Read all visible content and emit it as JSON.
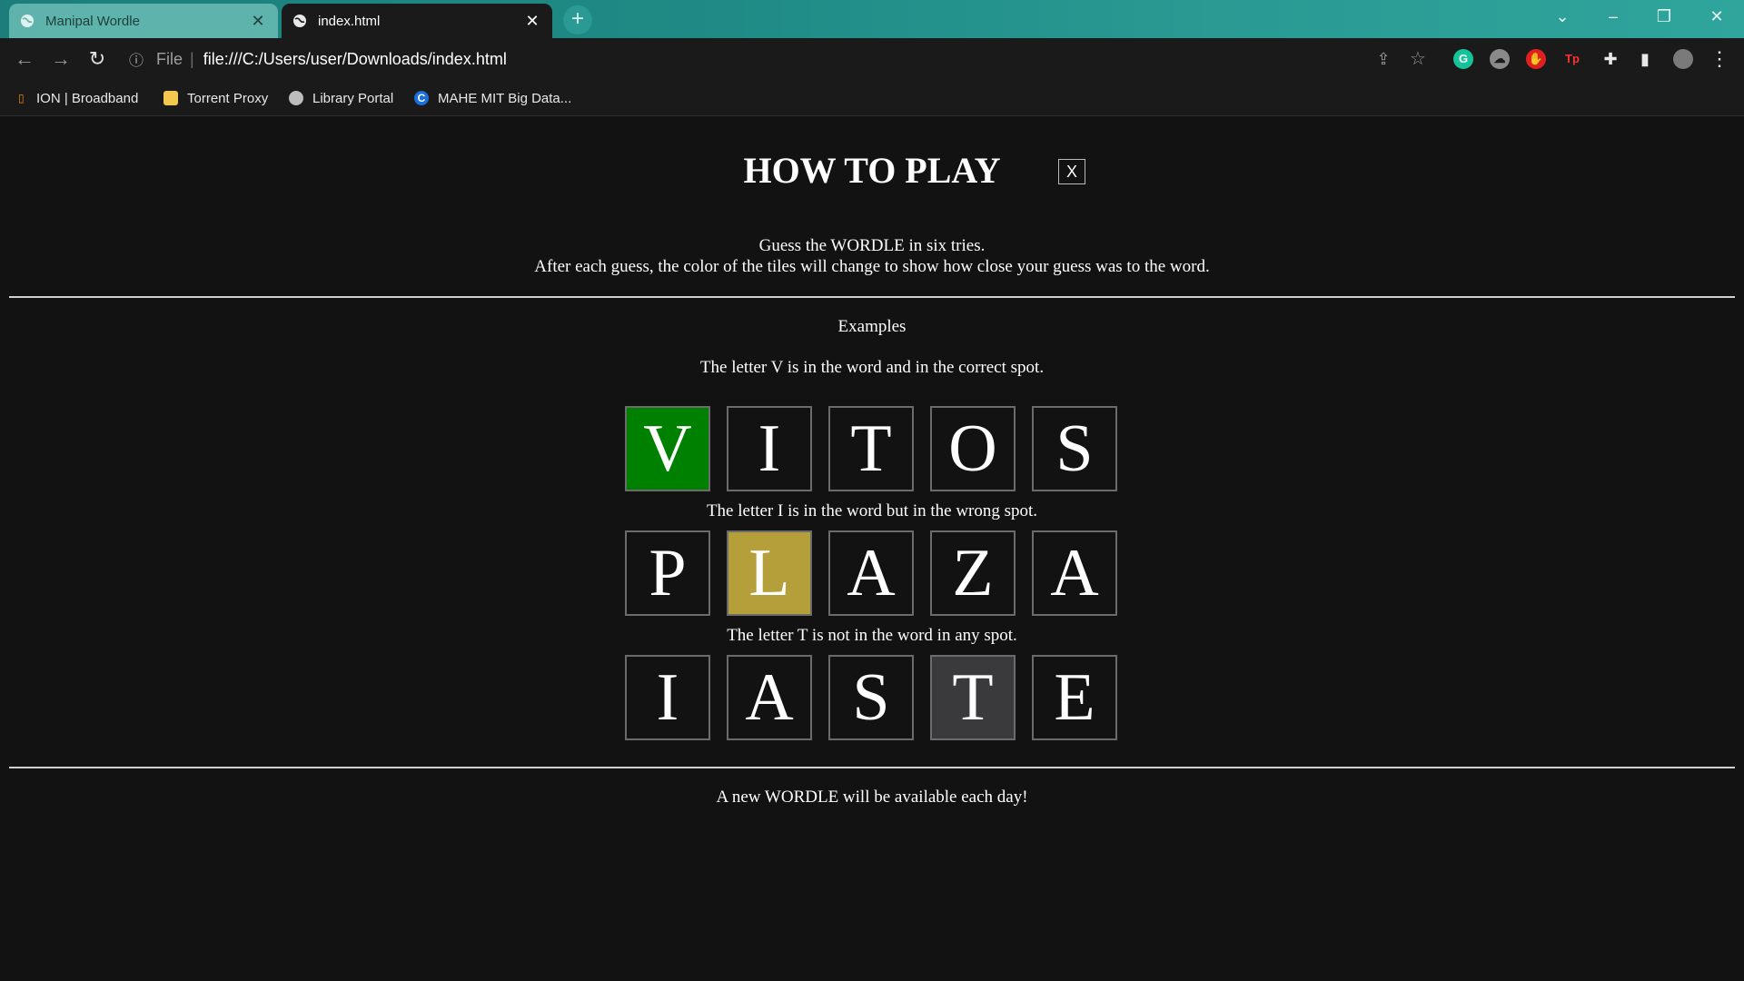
{
  "browser": {
    "tabs": [
      {
        "title": "Manipal Wordle",
        "active": false
      },
      {
        "title": "index.html",
        "active": true
      }
    ],
    "url_scheme": "File",
    "url": "file:///C:/Users/user/Downloads/index.html",
    "bookmarks": [
      "ION | Broadband",
      "Torrent Proxy",
      "Library Portal",
      "MAHE MIT Big Data..."
    ]
  },
  "page": {
    "title": "HOW TO PLAY",
    "close_label": "X",
    "intro_line1": "Guess the WORDLE in six tries.",
    "intro_line2": "After each guess, the color of the tiles will change to show how close your guess was to the word.",
    "examples_heading": "Examples",
    "examples": [
      {
        "caption": "The letter V is in the word and in the correct spot.",
        "letters": [
          "V",
          "I",
          "T",
          "O",
          "S"
        ],
        "highlight_index": 0,
        "highlight_color": "#008000"
      },
      {
        "caption": "The letter I is in the word but in the wrong spot.",
        "letters": [
          "P",
          "L",
          "A",
          "Z",
          "A"
        ],
        "highlight_index": 1,
        "highlight_color": "#b59f3b"
      },
      {
        "caption": "The letter T is not in the word in any spot.",
        "letters": [
          "I",
          "A",
          "S",
          "T",
          "E"
        ],
        "highlight_index": 3,
        "highlight_color": "#3a3a3c"
      }
    ],
    "footer": "A new WORDLE will be available each day!"
  }
}
